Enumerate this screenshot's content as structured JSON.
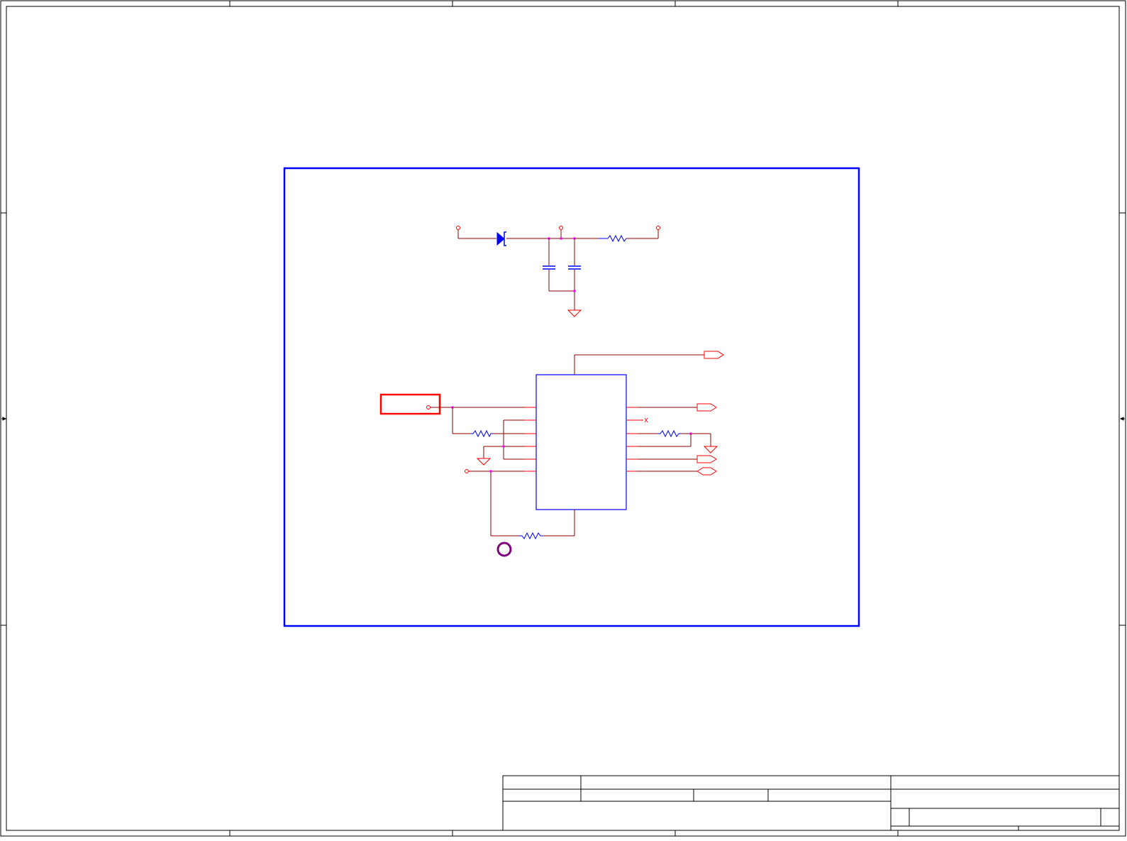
{
  "document": {
    "type": "schematic-sheet"
  },
  "colors": {
    "border": "#000000",
    "frame": "#0000ff",
    "wire": "#8b0000",
    "pin": "#ff0000",
    "symbol": "#0000ff",
    "junction": "#ff00ff",
    "highlight": "#ff0000",
    "marker": "#800080"
  },
  "icons": {
    "diode": "zener-diode-icon",
    "capacitor": "capacitor-icon",
    "resistor": "resistor-icon",
    "ground": "ground-icon",
    "port": "port-arrow-icon",
    "terminal": "terminal-circle-icon",
    "no_connect": "no-connect-x-icon",
    "ic": "ic-body-icon"
  },
  "title_block": {
    "cells": []
  }
}
